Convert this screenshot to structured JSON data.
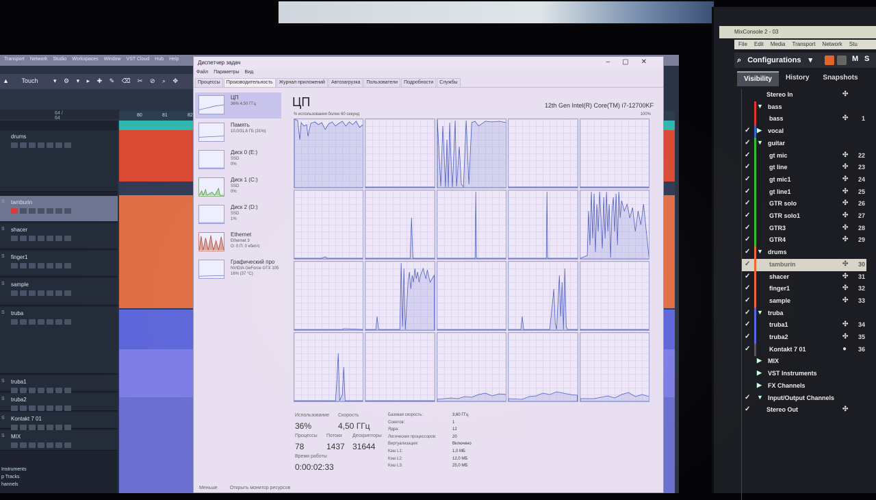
{
  "daw": {
    "menu": [
      "Transport",
      "Network",
      "Studio",
      "Workspaces",
      "Window",
      "VST Cloud",
      "Hub",
      "Help"
    ],
    "tool_mode": "Touch",
    "ruler_left": "64 / 64",
    "ruler_marks": [
      "80",
      "81",
      "82"
    ],
    "tracks": [
      {
        "name": "drums",
        "s": ""
      },
      {
        "name": "tamburin",
        "s": "S",
        "selected": true,
        "rec": true
      },
      {
        "name": "shacer",
        "s": "S"
      },
      {
        "name": "finger1",
        "s": "S"
      },
      {
        "name": "sample",
        "s": "S"
      },
      {
        "name": "truba",
        "s": "S"
      },
      {
        "name": "truba1",
        "s": "S"
      },
      {
        "name": "truba2",
        "s": "S"
      },
      {
        "name": "Kontakt 7 01",
        "s": "S"
      },
      {
        "name": "MIX",
        "s": "S"
      }
    ],
    "folders": [
      "Instruments",
      "p Tracks",
      "hannels"
    ]
  },
  "task_manager": {
    "title": "Диспетчер задач",
    "menu": [
      "Файл",
      "Параметры",
      "Вид"
    ],
    "tabs": [
      "Процессы",
      "Производительность",
      "Журнал приложений",
      "Автозагрузка",
      "Пользователи",
      "Подробности",
      "Службы"
    ],
    "active_tab": 1,
    "sidebar": [
      {
        "title": "ЦП",
        "l2": "36% 4,50 ГГц",
        "l3": ""
      },
      {
        "title": "Память",
        "l2": "10,0/31,8 ГБ (31%)",
        "l3": ""
      },
      {
        "title": "Диск 0 (E:)",
        "l2": "SSD",
        "l3": "0%"
      },
      {
        "title": "Диск 1 (C:)",
        "l2": "SSD",
        "l3": "0%"
      },
      {
        "title": "Диск 2 (D:)",
        "l2": "SSD",
        "l3": "1%"
      },
      {
        "title": "Ethernet",
        "l2": "Ethernet 3",
        "l3": "О: 0 П: 0 кбит/с"
      },
      {
        "title": "Графический про",
        "l2": "NVIDIA GeForce GTX 105",
        "l3": "16% (37 °C)"
      }
    ],
    "main_title": "ЦП",
    "cpu_name": "12th Gen Intel(R) Core(TM) i7-12700KF",
    "graph_label": "% использования более 60 секунд",
    "graph_max": "100%",
    "stats": {
      "usage_label": "Использование",
      "usage": "36%",
      "speed_label": "Скорость",
      "speed": "4,50 ГГц",
      "proc_label": "Процессы",
      "proc": "78",
      "threads_label": "Потоки",
      "threads": "1437",
      "handles_label": "Дескрипторы",
      "handles": "31644",
      "uptime_label": "Время работы",
      "uptime": "0:00:02:33"
    },
    "specs": [
      [
        "Базовая скорость:",
        "3,60 ГГц"
      ],
      [
        "Сокетов:",
        "1"
      ],
      [
        "Ядра:",
        "12"
      ],
      [
        "Логических процессоров:",
        "20"
      ],
      [
        "Виртуализация:",
        "Включено"
      ],
      [
        "Кэш L1:",
        "1,0 МБ"
      ],
      [
        "Кэш L2:",
        "12,0 МБ"
      ],
      [
        "Кэш L3:",
        "25,0 МБ"
      ]
    ],
    "footer": {
      "less": "Меньше",
      "open_monitor": "Открыть монитор ресурсов"
    }
  },
  "mixconsole": {
    "title": "MixConsole 2 - 03",
    "menu": [
      "File",
      "Edit",
      "Media",
      "Transport",
      "Network",
      "Stu"
    ],
    "configurations": "Configurations",
    "tabs": [
      "Visibility",
      "History",
      "Snapshots"
    ],
    "rows": [
      {
        "name": "Stereo In",
        "check": false,
        "color": "",
        "tri": "",
        "num": "",
        "ic": "✣"
      },
      {
        "name": "bass",
        "check": false,
        "color": "#d33",
        "tri": "▼",
        "num": "",
        "ic": ""
      },
      {
        "name": "bass",
        "check": false,
        "color": "#d33",
        "tri": "",
        "num": "1",
        "ic": "✣"
      },
      {
        "name": "vocal",
        "check": true,
        "color": "#36c",
        "tri": "▶",
        "num": "",
        "ic": ""
      },
      {
        "name": "guitar",
        "check": true,
        "color": "#3b3",
        "tri": "▼",
        "num": "",
        "ic": ""
      },
      {
        "name": "gt mic",
        "check": true,
        "color": "#3b3",
        "tri": "",
        "num": "22",
        "ic": "✣"
      },
      {
        "name": "gt line",
        "check": true,
        "color": "#3b3",
        "tri": "",
        "num": "23",
        "ic": "✣"
      },
      {
        "name": "gt mic1",
        "check": true,
        "color": "#3b3",
        "tri": "",
        "num": "24",
        "ic": "✣"
      },
      {
        "name": "gt line1",
        "check": true,
        "color": "#3b3",
        "tri": "",
        "num": "25",
        "ic": "✣"
      },
      {
        "name": "GTR solo",
        "check": true,
        "color": "#3b3",
        "tri": "",
        "num": "26",
        "ic": "✣"
      },
      {
        "name": "GTR solo1",
        "check": true,
        "color": "#3b3",
        "tri": "",
        "num": "27",
        "ic": "✣"
      },
      {
        "name": "GTR3",
        "check": true,
        "color": "#3b3",
        "tri": "",
        "num": "28",
        "ic": "✣"
      },
      {
        "name": "GTR4",
        "check": true,
        "color": "#3b3",
        "tri": "",
        "num": "29",
        "ic": "✣"
      },
      {
        "name": "drums",
        "check": true,
        "color": "#e63",
        "tri": "▼",
        "num": "",
        "ic": ""
      },
      {
        "name": "tamburin",
        "check": true,
        "color": "#e63",
        "tri": "",
        "num": "30",
        "ic": "✣",
        "selected": true
      },
      {
        "name": "shacer",
        "check": true,
        "color": "#e63",
        "tri": "",
        "num": "31",
        "ic": "✣"
      },
      {
        "name": "finger1",
        "check": true,
        "color": "#e63",
        "tri": "",
        "num": "32",
        "ic": "✣"
      },
      {
        "name": "sample",
        "check": true,
        "color": "#e63",
        "tri": "",
        "num": "33",
        "ic": "✣"
      },
      {
        "name": "truba",
        "check": true,
        "color": "#56d",
        "tri": "▼",
        "num": "",
        "ic": ""
      },
      {
        "name": "truba1",
        "check": true,
        "color": "#56d",
        "tri": "",
        "num": "34",
        "ic": "✣"
      },
      {
        "name": "truba2",
        "check": true,
        "color": "#56d",
        "tri": "",
        "num": "35",
        "ic": "✣"
      },
      {
        "name": "Kontakt 7 01",
        "check": true,
        "color": "#555",
        "tri": "",
        "num": "36",
        "ic": "●"
      },
      {
        "name": "MIX",
        "check": false,
        "color": "",
        "tri": "▶",
        "num": "",
        "ic": ""
      },
      {
        "name": "VST Instruments",
        "check": false,
        "color": "",
        "tri": "▶",
        "num": "",
        "ic": ""
      },
      {
        "name": "FX Channels",
        "check": false,
        "color": "",
        "tri": "▶",
        "num": "",
        "ic": ""
      },
      {
        "name": "Input/Output Channels",
        "check": true,
        "color": "",
        "tri": "▼",
        "num": "",
        "ic": ""
      },
      {
        "name": "Stereo Out",
        "check": true,
        "color": "",
        "tri": "",
        "num": "",
        "ic": "✣"
      }
    ]
  }
}
